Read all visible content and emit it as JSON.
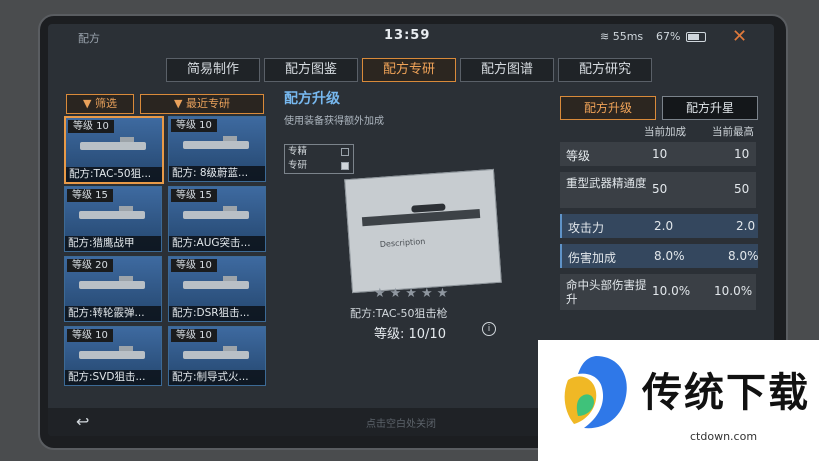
{
  "status": {
    "title": "配方",
    "time": "13:59",
    "network": "55ms",
    "battery": "67%"
  },
  "tabs": [
    "简易制作",
    "配方图鉴",
    "配方专研",
    "配方图谱",
    "配方研究"
  ],
  "filters": {
    "filter_label": "筛选",
    "recent_label": "最近专研"
  },
  "cards": [
    {
      "level": "等级 10",
      "name": "配方:TAC-50狙..."
    },
    {
      "level": "等级 10",
      "name": "配方: 8级蔚蓝..."
    },
    {
      "level": "等级 15",
      "name": "配方:猎鹰战甲"
    },
    {
      "level": "等级 15",
      "name": "配方:AUG突击..."
    },
    {
      "level": "等级 20",
      "name": "配方:转轮霰弹..."
    },
    {
      "level": "等级 10",
      "name": "配方:DSR狙击..."
    },
    {
      "level": "等级 10",
      "name": "配方:SVD狙击..."
    },
    {
      "level": "等级 10",
      "name": "配方:制导式火..."
    }
  ],
  "upgrade": {
    "title": "配方升级",
    "subtitle": "使用装备获得额外加成",
    "check_expert": "专精",
    "check_research": "专研",
    "paper_label": "Description",
    "weapon_name": "配方:TAC-50狙击枪",
    "level_readout": "等级: 10/10",
    "stars": "★★★★★",
    "star_count": 5
  },
  "right_panel": {
    "tab_upgrade": "配方升级",
    "tab_star": "配方升星",
    "col_current": "当前加成",
    "col_max": "当前最高",
    "rows": [
      {
        "label": "等级",
        "current": "10",
        "max": "10"
      },
      {
        "label": "重型武器精通度",
        "current": "50",
        "max": "50"
      },
      {
        "label": "攻击力",
        "current": "2.0",
        "max": "2.0"
      },
      {
        "label": "伤害加成",
        "current": "8.0%",
        "max": "8.0%"
      },
      {
        "label": "命中头部伤害提升",
        "current": "10.0%",
        "max": "10.0%"
      }
    ]
  },
  "bottom": {
    "hint": "点击空白处关闭",
    "back_icon": "↩"
  },
  "watermark": {
    "text": "传统下载",
    "url": "ctdown.com"
  }
}
